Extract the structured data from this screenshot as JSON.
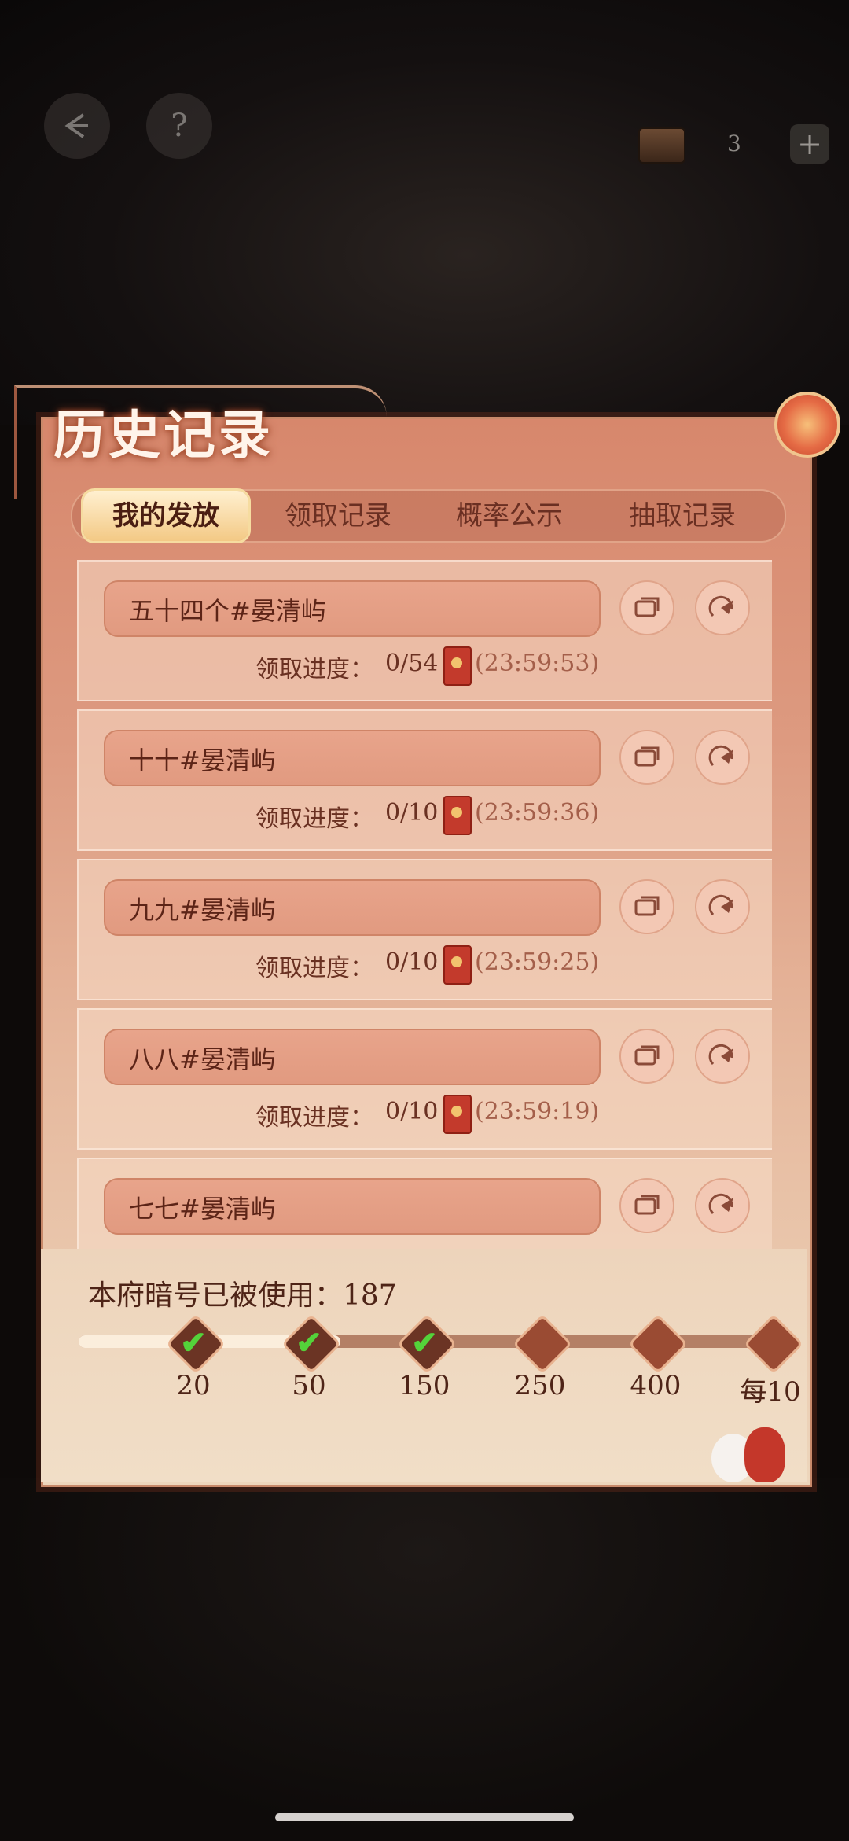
{
  "topbar": {
    "back_icon": "back-arrow-icon",
    "help_label": "?",
    "currency_count": "3",
    "add_label": "+"
  },
  "title": "历史记录",
  "tabs": [
    {
      "label": "我的发放",
      "active": true
    },
    {
      "label": "领取记录",
      "active": false
    },
    {
      "label": "概率公示",
      "active": false
    },
    {
      "label": "抽取记录",
      "active": false
    }
  ],
  "records": [
    {
      "name": "五十四个#晏清屿",
      "progress_label": "领取进度：",
      "progress_value": "0/54",
      "time": "(23:59:53)"
    },
    {
      "name": "十十#晏清屿",
      "progress_label": "领取进度：",
      "progress_value": "0/10",
      "time": "(23:59:36)"
    },
    {
      "name": "九九#晏清屿",
      "progress_label": "领取进度：",
      "progress_value": "0/10",
      "time": "(23:59:25)"
    },
    {
      "name": "八八#晏清屿",
      "progress_label": "领取进度：",
      "progress_value": "0/10",
      "time": "(23:59:19)"
    },
    {
      "name": "七七#晏清屿",
      "progress_label": "",
      "progress_value": "",
      "time": ""
    }
  ],
  "usage": {
    "label": "本府暗号已被使用：187",
    "used_count": 187,
    "milestones": [
      {
        "label": "20",
        "achieved": true
      },
      {
        "label": "50",
        "achieved": true
      },
      {
        "label": "150",
        "achieved": true
      },
      {
        "label": "250",
        "achieved": false
      },
      {
        "label": "400",
        "achieved": false
      },
      {
        "label": "每10",
        "achieved": false
      }
    ],
    "progress_fraction": 0.37
  },
  "colors": {
    "panel": "#dd9a80",
    "tab_active": "#f3c985",
    "text_dark": "#5c2417",
    "check": "#54d23a",
    "envelope": "#c33a2c"
  }
}
